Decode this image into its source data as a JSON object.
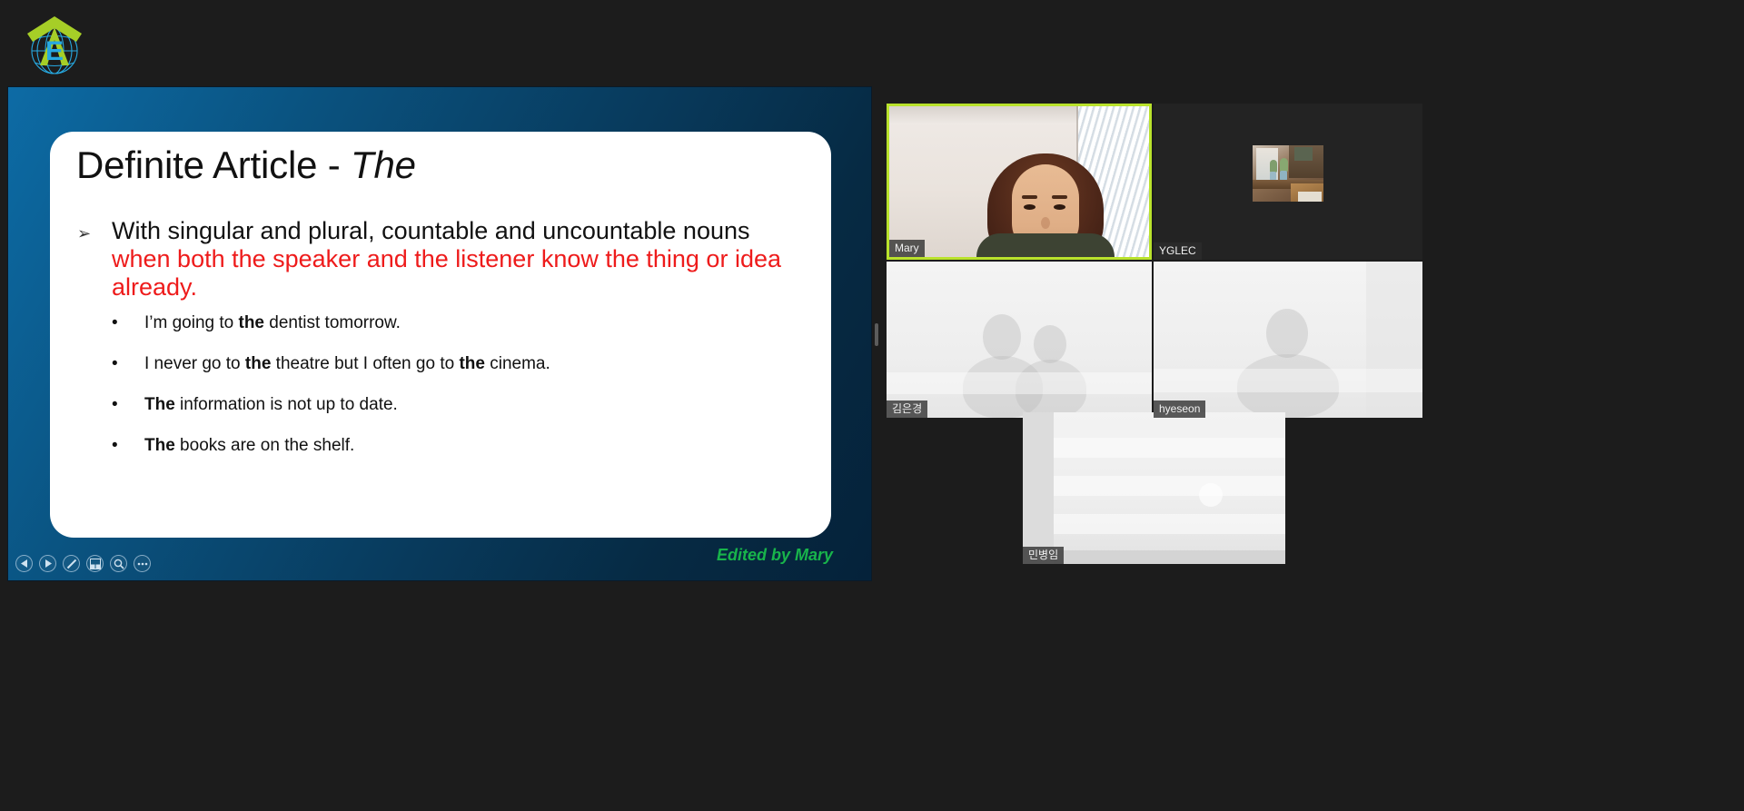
{
  "app": {
    "background_color": "#1c1c1c"
  },
  "logo": {
    "name": "organization-logo",
    "letter": "E",
    "arrow_color": "#a6ce27",
    "globe_color": "#27a9e1"
  },
  "slide": {
    "title_plain": "Definite Article - ",
    "title_italic": "The",
    "main_bullet_marker": "➢",
    "main_bullet_black": "With singular and plural, countable and uncountable nouns",
    "main_bullet_red": "when both the speaker and the listener know the thing or idea already.",
    "red_color": "#ee1b1b",
    "examples": [
      {
        "marker": "•",
        "before": "I’m going to ",
        "bold1": "the",
        "mid": " dentist tomorrow.",
        "bold2": "",
        "after": ""
      },
      {
        "marker": "•",
        "before": "I never go to ",
        "bold1": "the",
        "mid": " theatre but I often go to ",
        "bold2": "the",
        "after": " cinema."
      },
      {
        "marker": "•",
        "before": "",
        "bold1": "The",
        "mid": " information is not up to date.",
        "bold2": "",
        "after": ""
      },
      {
        "marker": "•",
        "before": "",
        "bold1": "The",
        "mid": " books are on the shelf.",
        "bold2": "",
        "after": ""
      }
    ],
    "footer_credit": "Edited by Mary",
    "footer_credit_color": "#18b44b"
  },
  "slide_toolbar": {
    "items": [
      {
        "name": "previous-slide-button",
        "icon": "triangle-left-icon",
        "label": "Previous"
      },
      {
        "name": "next-slide-button",
        "icon": "triangle-right-icon",
        "label": "Next"
      },
      {
        "name": "annotate-button",
        "icon": "pen-icon",
        "label": "Annotate"
      },
      {
        "name": "layout-button",
        "icon": "layout-grid-icon",
        "label": "Layout"
      },
      {
        "name": "zoom-button",
        "icon": "magnifier-icon",
        "label": "Zoom"
      },
      {
        "name": "more-options-button",
        "icon": "ellipsis-icon",
        "label": "More"
      }
    ]
  },
  "participants": [
    {
      "name": "Mary",
      "active_speaker": true,
      "border_color": "#b9e22c"
    },
    {
      "name": "YGLEC",
      "active_speaker": false
    },
    {
      "name": "김은경",
      "active_speaker": false
    },
    {
      "name": "hyeseon",
      "active_speaker": false
    },
    {
      "name": "민병임",
      "active_speaker": false
    }
  ]
}
